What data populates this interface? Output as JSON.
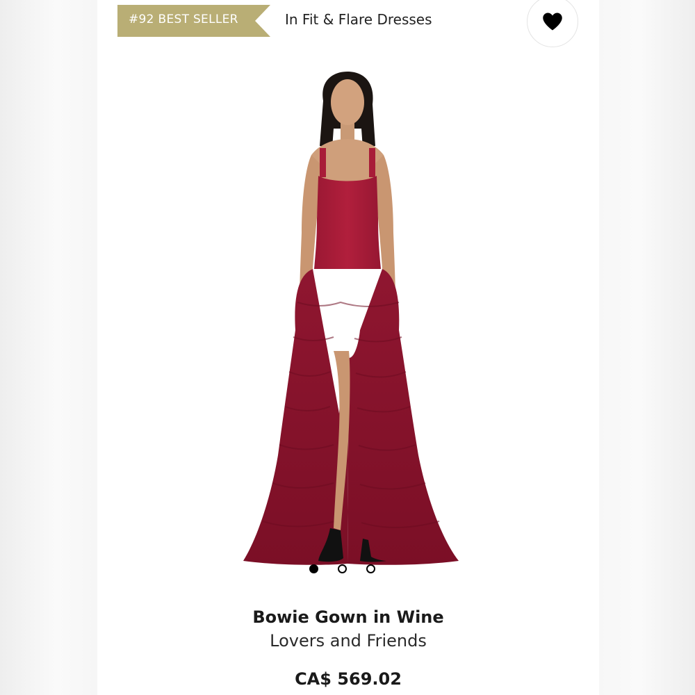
{
  "badge": {
    "text": "#92 BEST SELLER",
    "color": "#b9ae75"
  },
  "category": {
    "text": "In Fit & Flare Dresses"
  },
  "favorite": {
    "icon": "heart-icon"
  },
  "gallery": {
    "image_count": 3,
    "active_index": 0
  },
  "product": {
    "name": "Bowie Gown in Wine",
    "brand": "Lovers and Friends",
    "price": "CA$ 569.02",
    "dress_color": "#9e1b34"
  }
}
